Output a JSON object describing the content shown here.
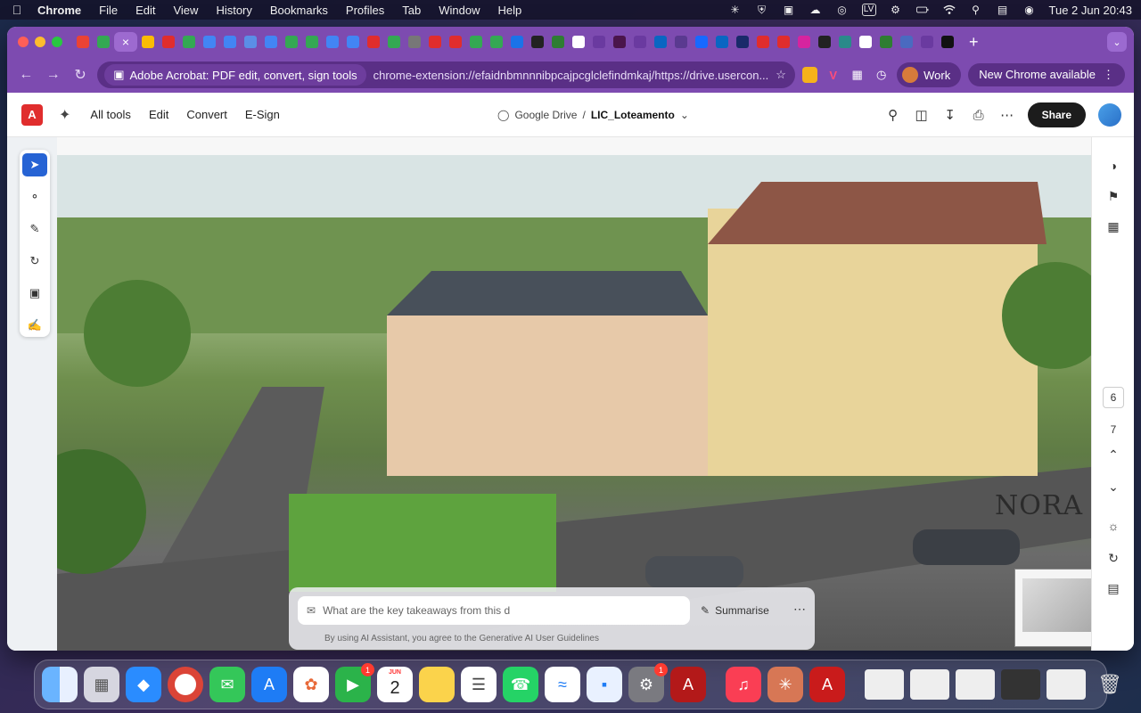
{
  "menubar": {
    "app": "Chrome",
    "items": [
      "File",
      "Edit",
      "View",
      "History",
      "Bookmarks",
      "Profiles",
      "Tab",
      "Window",
      "Help"
    ],
    "status": {
      "input_badge": "LV",
      "date_time": "Tue 2 Jun  20:43"
    }
  },
  "browser": {
    "omnibox": {
      "site_chip": "Adobe Acrobat: PDF edit, convert, sign tools",
      "url": "chrome-extension://efaidnbmnnnibpcajpcglclefindmkaj/https://drive.usercon..."
    },
    "profile": "Work",
    "update": "New Chrome available"
  },
  "acrobat": {
    "menu": [
      "All tools",
      "Edit",
      "Convert",
      "E-Sign"
    ],
    "breadcrumb": {
      "location": "Google Drive",
      "separator": "/",
      "file": "LIC_Loteamento"
    },
    "share": "Share",
    "page_numbers": [
      "6",
      "7"
    ],
    "ai": {
      "placeholder": "What are the key takeaways from this d",
      "summarise": "Summarise",
      "terms": "By using AI Assistant, you agree to the Generative AI User Guidelines"
    },
    "watermark": "NORA"
  },
  "dock": {
    "calendar": {
      "month": "JUN",
      "day": "2"
    },
    "badges": {
      "facetime": "1",
      "settings": "1"
    }
  },
  "colors": {
    "chrome_purple": "#7d4bb0",
    "acrobat_red": "#e02d2d",
    "selection_blue": "#2663d4"
  }
}
